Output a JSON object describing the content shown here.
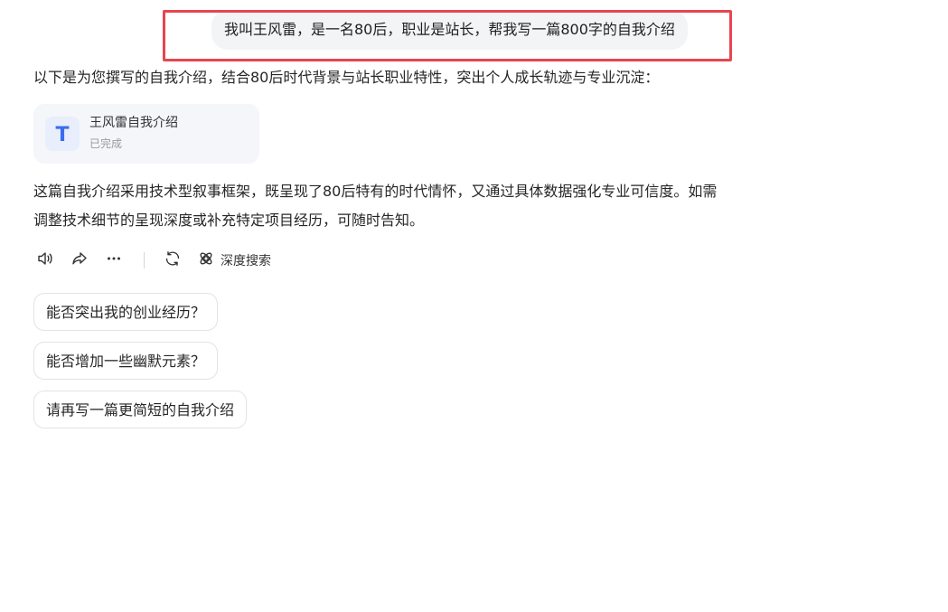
{
  "user_message": {
    "text": "我叫王风雷，是一名80后，职业是站长，帮我写一篇800字的自我介绍"
  },
  "response": {
    "intro": "以下是为您撰写的自我介绍，结合80后时代背景与站长职业特性，突出个人成长轨迹与专业沉淀：",
    "document_card": {
      "icon": "T",
      "title": "王风雷自我介绍",
      "status": "已完成"
    },
    "summary": "这篇自我介绍采用技术型叙事框架，既呈现了80后特有的时代情怀，又通过具体数据强化专业可信度。如需调整技术细节的呈现深度或补充特定项目经历，可随时告知。"
  },
  "toolbar": {
    "icons": [
      "speaker-icon",
      "share-icon",
      "more-icon",
      "regenerate-icon",
      "deep-search-icon"
    ],
    "deep_search_label": "深度搜索"
  },
  "suggestions": [
    "能否突出我的创业经历？",
    "能否增加一些幽默元素？",
    "请再写一篇更简短的自我介绍"
  ],
  "colors": {
    "highlight_frame": "#e8454f",
    "doc_icon": "#3b6cf0",
    "bubble_bg": "#f3f4f6"
  }
}
